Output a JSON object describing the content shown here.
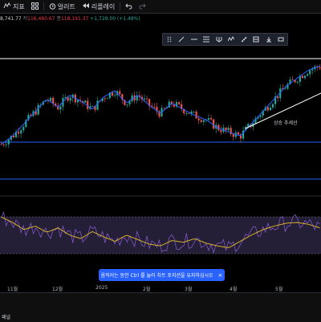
{
  "toolbar": {
    "indicators_label": "지표",
    "alert_label": "얼러트",
    "replay_label": "리플레이"
  },
  "ohlc": {
    "partial_open": "8,741.77",
    "high_label": "저",
    "high_value": "116,460.67",
    "close_label": "종",
    "close_value": "118,191.37",
    "change": "+1,729.00 (+1.48%)"
  },
  "drawing_toolbar": {
    "icons": [
      "drag-handle-icon",
      "trendline-icon",
      "horizontal-line-icon",
      "fib-retracement-icon",
      "pitchfork-icon",
      "pattern-icon",
      "ruler-icon",
      "long-position-icon",
      "short-position-icon",
      "rectangle-icon"
    ]
  },
  "annotation_text": "상승 추세선",
  "toast": {
    "message": "움직이는 동안 Ctrl 를 눌러 차트 포지션을 유지하십시오",
    "close_glyph": "×"
  },
  "time_axis": {
    "labels": [
      "11월",
      "12월",
      "2025",
      "2월",
      "3월",
      "4월",
      "5월"
    ]
  },
  "bottom_panel": {
    "label": "패널"
  },
  "colors": {
    "background": "#000000",
    "up_candle": "#26a69a",
    "down_candle": "#ef5350",
    "moving_average": "#2962ff",
    "support_line": "#2962ff",
    "resistance_line": "#ffffff",
    "rsi_fill": "#2e2545",
    "rsi_fast": "#7e57c2",
    "rsi_signal": "#d4b12a",
    "toast": "#2962ff"
  },
  "chart_data": {
    "type": "candlestick",
    "price_series": [
      80000,
      84000,
      90000,
      96000,
      102000,
      98000,
      104000,
      101000,
      97000,
      103000,
      106000,
      100000,
      104000,
      99000,
      95000,
      100000,
      97000,
      94000,
      92000,
      88000,
      86000,
      84000,
      90000,
      96000,
      102000,
      108000,
      112000,
      116000,
      118000
    ],
    "rsi_series": [
      72,
      66,
      58,
      62,
      55,
      60,
      52,
      48,
      56,
      50,
      45,
      52,
      47,
      42,
      40,
      46,
      44,
      48,
      43,
      40,
      38,
      45,
      52,
      58,
      62,
      65,
      66,
      64,
      60
    ]
  }
}
